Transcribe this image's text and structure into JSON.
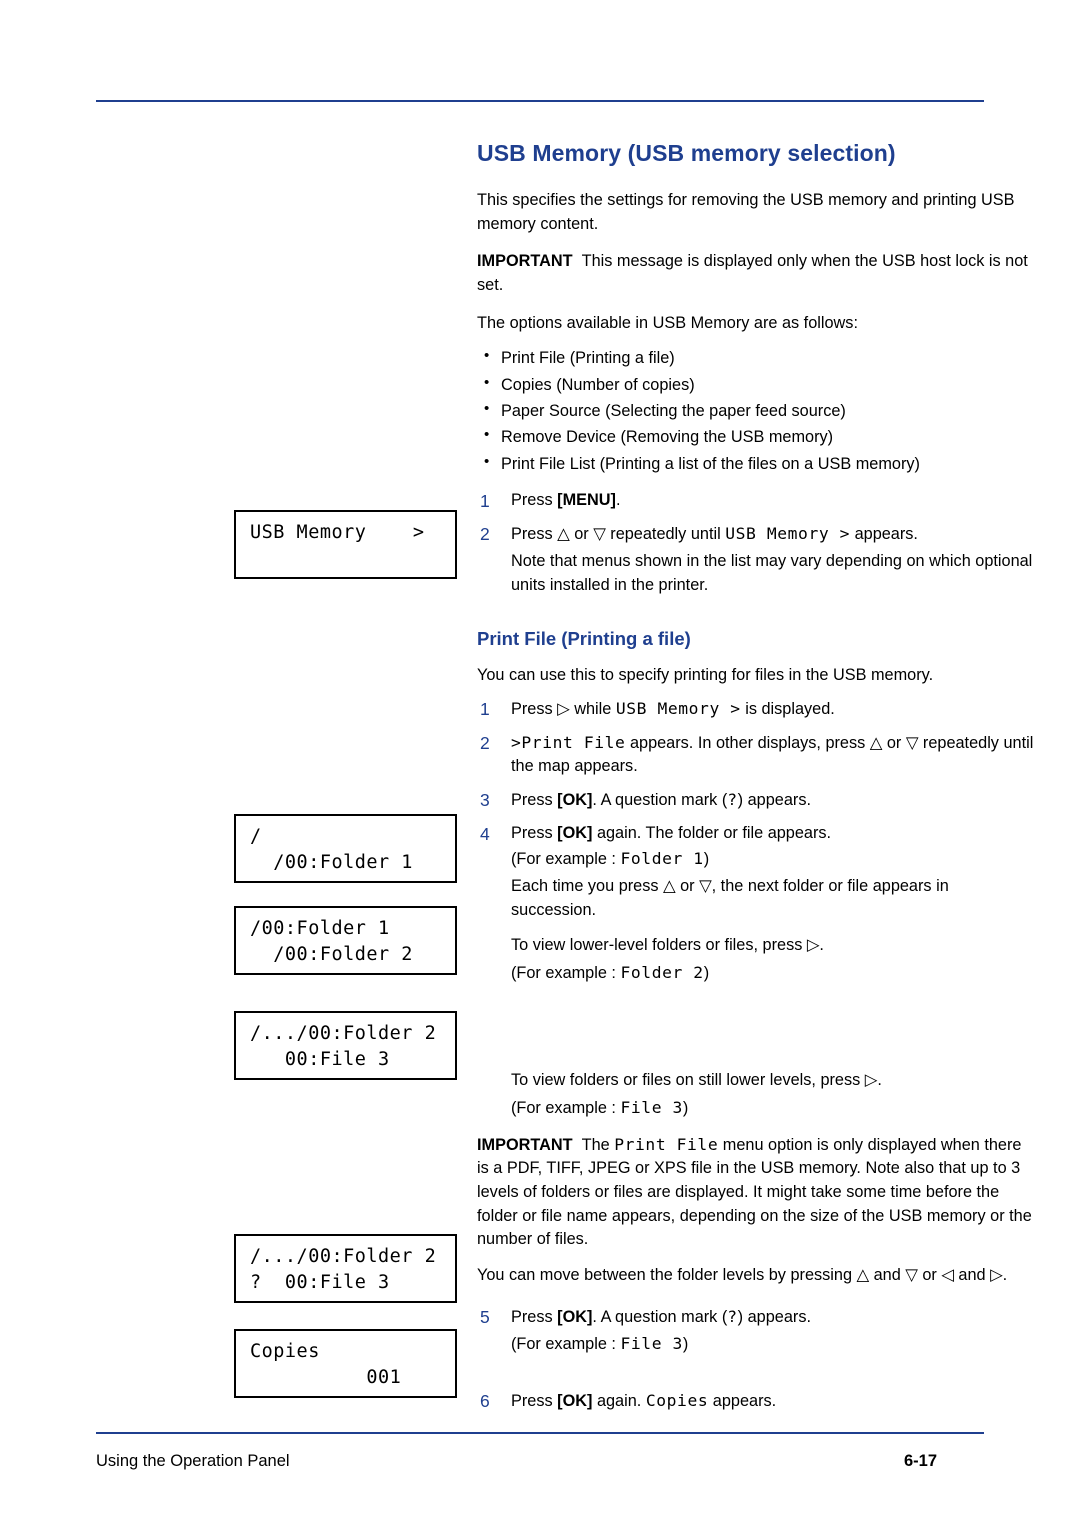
{
  "footer": {
    "left": "Using the Operation Panel",
    "right": "6-17"
  },
  "main": {
    "title": "USB Memory (USB memory selection)",
    "intro": "This specifies the settings for removing the USB memory and printing USB memory content.",
    "important_label": "IMPORTANT",
    "important_text": "This message is displayed only when the USB host lock is not set.",
    "options_lead": "The options available in USB Memory are as follows:",
    "options": [
      "Print File (Printing a file)",
      "Copies (Number of copies)",
      "Paper Source (Selecting the paper feed source)",
      "Remove Device (Removing the USB memory)",
      "Print File List (Printing a list of the files on a USB memory)"
    ],
    "steps": [
      {
        "num": "1",
        "parts": [
          {
            "t": "Press ",
            "s": "n"
          },
          {
            "t": "[MENU]",
            "s": "b"
          },
          {
            "t": ".",
            "s": "n"
          }
        ]
      },
      {
        "num": "2",
        "parts": [
          {
            "t": "Press ",
            "s": "n"
          },
          {
            "t": "△",
            "s": "n"
          },
          {
            "t": " or ",
            "s": "n"
          },
          {
            "t": "▽",
            "s": "n"
          },
          {
            "t": " repeatedly until ",
            "s": "n"
          },
          {
            "t": "USB Memory >",
            "s": "m"
          },
          {
            "t": " appears.",
            "s": "n"
          }
        ]
      }
    ],
    "note_menus": "Note that menus shown in the list may vary depending on which optional units installed in the printer.",
    "section2_title": "Print File (Printing a file)",
    "section2_intro": "You can use this to specify printing for files in the USB memory.",
    "section2_steps": [
      {
        "num": "1",
        "parts": [
          {
            "t": "Press ",
            "s": "n"
          },
          {
            "t": "▷",
            "s": "n"
          },
          {
            "t": " while ",
            "s": "n"
          },
          {
            "t": "USB Memory >",
            "s": "m"
          },
          {
            "t": " is displayed.",
            "s": "n"
          }
        ]
      },
      {
        "num": "2",
        "parts": [
          {
            "t": ">Print File",
            "s": "m"
          },
          {
            "t": " appears. In other displays, press ",
            "s": "n"
          },
          {
            "t": "△",
            "s": "n"
          },
          {
            "t": " or ",
            "s": "n"
          },
          {
            "t": "▽",
            "s": "n"
          },
          {
            "t": " repeatedly until the map appears.",
            "s": "n"
          }
        ]
      },
      {
        "num": "3",
        "parts": [
          {
            "t": "Press ",
            "s": "n"
          },
          {
            "t": "[OK]",
            "s": "b"
          },
          {
            "t": ". A question mark (",
            "s": "n"
          },
          {
            "t": "?",
            "s": "m"
          },
          {
            "t": ") appears.",
            "s": "n"
          }
        ]
      },
      {
        "num": "4",
        "parts": [
          {
            "t": "Press ",
            "s": "n"
          },
          {
            "t": "[OK]",
            "s": "b"
          },
          {
            "t": " again. The folder or file appears.",
            "s": "n"
          }
        ]
      }
    ],
    "step4_example": "(For example : Folder 1)",
    "step4_example_mono": "Folder 1",
    "step4_note1": "Each time you press △ or ▽, the next folder or file appears in succession.",
    "step4_note2": "To view lower-level folders or files, press ▷.",
    "step4_example2_pre": "(For example : ",
    "step4_example2_mono": "Folder 2",
    "step4_example2_post": ")",
    "note_lower": "To view folders or files on still lower levels, press ▷.",
    "note_lower_example_pre": "(For example : ",
    "note_lower_example_mono": "File 3",
    "note_lower_example_post": ")",
    "important2_label": "IMPORTANT",
    "important2_parts": [
      {
        "t": "The ",
        "s": "n"
      },
      {
        "t": "Print File",
        "s": "m"
      },
      {
        "t": " menu option is only displayed when there is a PDF, TIFF, JPEG or XPS file in the USB memory. Note also that up to 3 levels of folders or files are displayed. It might take some time before the folder or file name appears, depending on the size of the USB memory or the number of files.",
        "s": "n"
      }
    ],
    "move_note": "You can move between the folder levels by pressing △ and ▽ or ◁ and ▷.",
    "steps_tail": [
      {
        "num": "5",
        "parts": [
          {
            "t": "Press ",
            "s": "n"
          },
          {
            "t": "[OK]",
            "s": "b"
          },
          {
            "t": ". A question mark (",
            "s": "n"
          },
          {
            "t": "?",
            "s": "m"
          },
          {
            "t": ") appears.",
            "s": "n"
          }
        ]
      },
      {
        "num": "6",
        "parts": [
          {
            "t": "Press ",
            "s": "n"
          },
          {
            "t": "[OK]",
            "s": "b"
          },
          {
            "t": " again. ",
            "s": "n"
          },
          {
            "t": "Copies",
            "s": "m"
          },
          {
            "t": " appears.",
            "s": "n"
          }
        ]
      }
    ],
    "step5_example_pre": "(For example : ",
    "step5_example_mono": "File 3",
    "step5_example_post": ")"
  },
  "lcd_panels": [
    {
      "name": "usb-memory",
      "line1": "USB Memory    >",
      "line2": ""
    },
    {
      "name": "root-folder1",
      "line1": "/",
      "line2": "  /00:Folder 1"
    },
    {
      "name": "folder1-folder2",
      "line1": "/00:Folder 1",
      "line2": "  /00:Folder 2"
    },
    {
      "name": "folder2-file3",
      "line1": "/.../00:Folder 2",
      "line2": "   00:File 3"
    },
    {
      "name": "folder2-file3-query",
      "line1": "/.../00:Folder 2",
      "line2": "?  00:File 3"
    },
    {
      "name": "copies",
      "line1": "Copies",
      "line2": "          001"
    }
  ]
}
